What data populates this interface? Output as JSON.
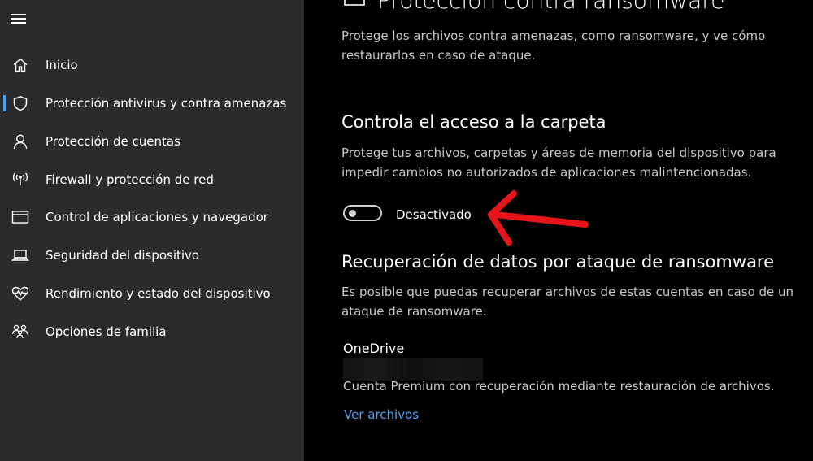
{
  "colors": {
    "sidebar_bg": "#2b2b2b",
    "main_bg": "#000000",
    "accent": "#4ea1f3",
    "arrow": "#e8141c"
  },
  "sidebar": {
    "items": [
      {
        "label": "Inicio",
        "icon": "home-icon"
      },
      {
        "label": "Protección antivirus y contra amenazas",
        "icon": "shield-icon",
        "active": true
      },
      {
        "label": "Protección de cuentas",
        "icon": "person-icon"
      },
      {
        "label": "Firewall y protección de red",
        "icon": "wireless-antenna-icon"
      },
      {
        "label": "Control de aplicaciones y navegador",
        "icon": "browser-window-icon"
      },
      {
        "label": "Seguridad del dispositivo",
        "icon": "laptop-icon"
      },
      {
        "label": "Rendimiento y estado del dispositivo",
        "icon": "heart-pulse-icon"
      },
      {
        "label": "Opciones de familia",
        "icon": "family-icon"
      }
    ]
  },
  "main": {
    "title": "Protección contra ransomware",
    "description": "Protege los archivos contra amenazas, como ransomware, y ve cómo restaurarlos en caso de ataque.",
    "controlled_access": {
      "title": "Controla el acceso a la carpeta",
      "description": "Protege tus archivos, carpetas y áreas de memoria del dispositivo para impedir cambios no autorizados de aplicaciones malintencionadas.",
      "toggle_label": "Desactivado",
      "toggle_on": false
    },
    "recovery": {
      "title": "Recuperación de datos por ataque de ransomware",
      "description": "Es posible que puedas recuperar archivos de estas cuentas en caso de un ataque de ransomware.",
      "account_name": "OneDrive",
      "account_description": "Cuenta Premium con recuperación mediante restauración de archivos.",
      "link": "Ver archivos"
    }
  }
}
